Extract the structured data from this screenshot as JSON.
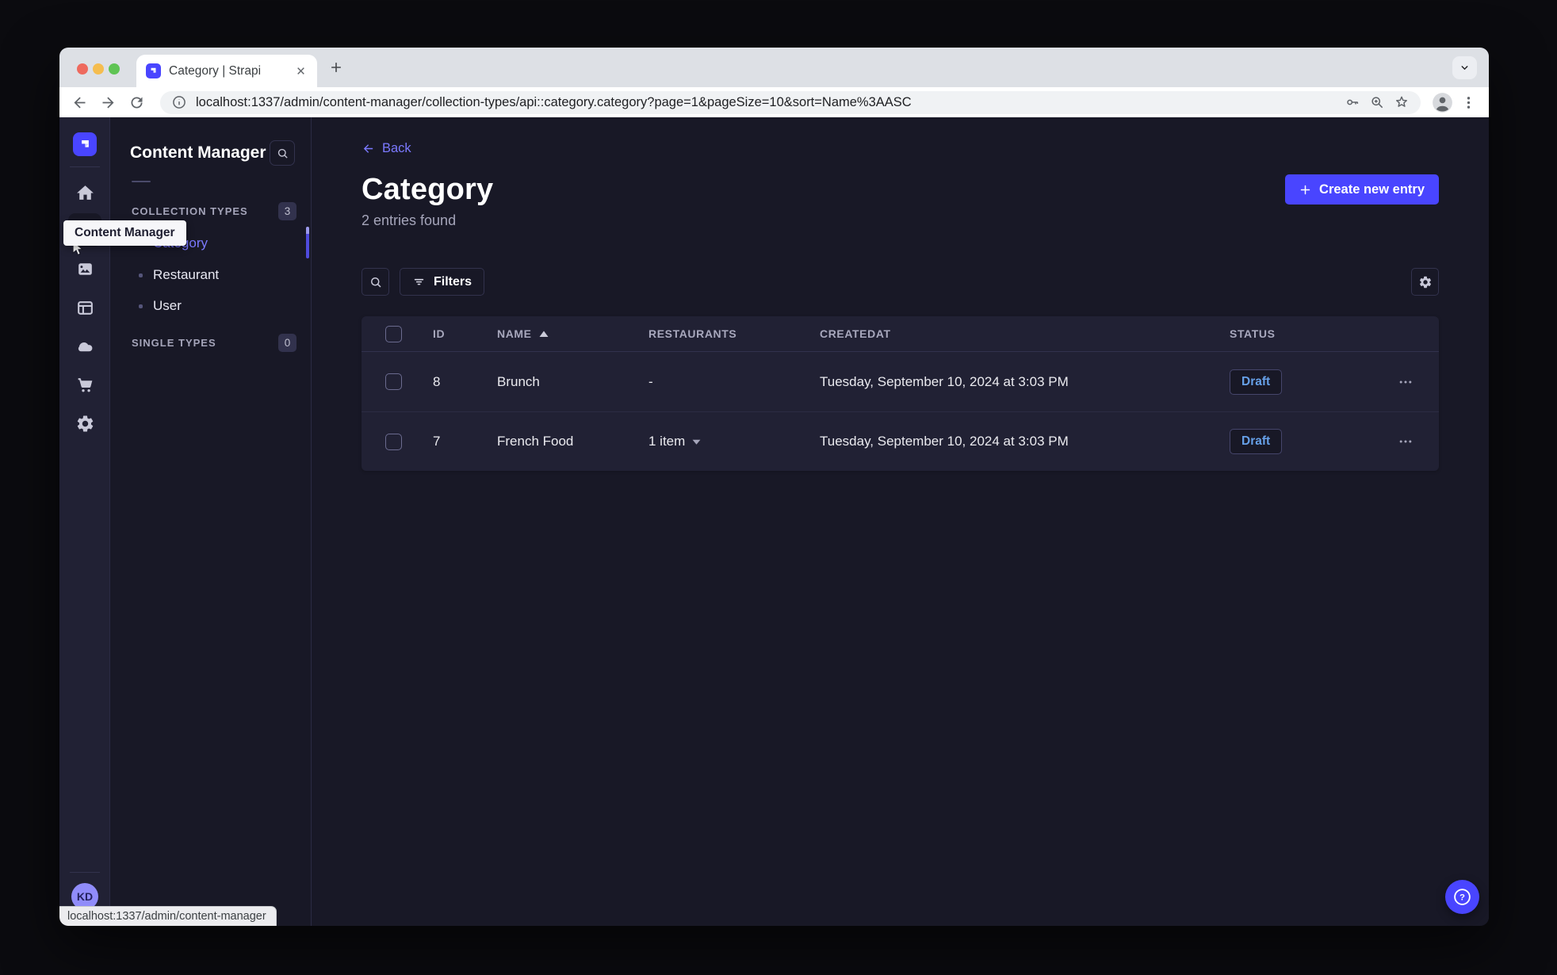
{
  "browser": {
    "tab_title": "Category | Strapi",
    "url": "localhost:1337/admin/content-manager/collection-types/api::category.category?page=1&pageSize=10&sort=Name%3AASC",
    "status_bar_text": "localhost:1337/admin/content-manager"
  },
  "colors": {
    "accent": "#4945ff",
    "accent_light": "#7b79ff",
    "page_bg": "#181826",
    "surface_bg": "#212134",
    "draft_text": "#66a0e8"
  },
  "icons": {
    "question": "?"
  },
  "sidebar": {
    "tooltip": "Content Manager",
    "avatar_initials": "KD"
  },
  "subnav": {
    "title": "Content Manager",
    "sections": [
      {
        "label": "COLLECTION TYPES",
        "badge": "3",
        "items": [
          {
            "label": "Category",
            "active": true
          },
          {
            "label": "Restaurant",
            "active": false
          },
          {
            "label": "User",
            "active": false
          }
        ]
      },
      {
        "label": "SINGLE TYPES",
        "badge": "0",
        "items": []
      }
    ]
  },
  "main": {
    "back_label": "Back",
    "title": "Category",
    "subtitle": "2 entries found",
    "create_button_label": "Create new entry",
    "filters_label": "Filters",
    "table": {
      "headers": [
        "ID",
        "NAME",
        "RESTAURANTS",
        "CREATEDAT",
        "STATUS"
      ],
      "rows": [
        {
          "id": "8",
          "name": "Brunch",
          "restaurants": "-",
          "created_at": "Tuesday, September 10, 2024 at 3:03 PM",
          "status": "Draft"
        },
        {
          "id": "7",
          "name": "French Food",
          "restaurants": "1 item",
          "created_at": "Tuesday, September 10, 2024 at 3:03 PM",
          "status": "Draft"
        }
      ]
    }
  }
}
